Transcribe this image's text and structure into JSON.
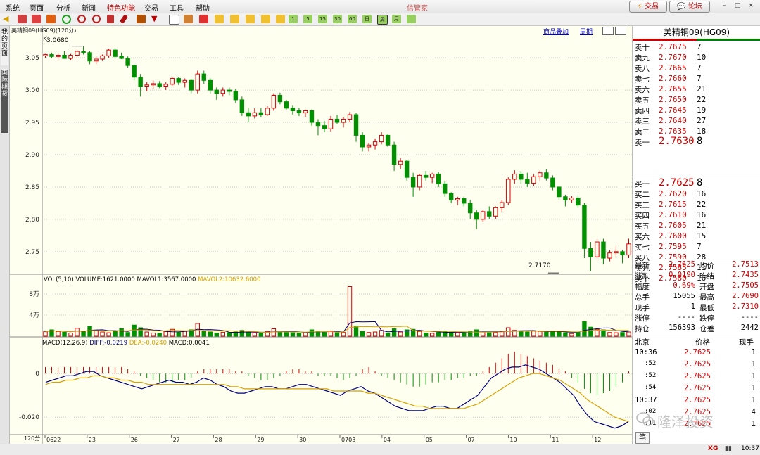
{
  "menu": [
    "系统",
    "页面",
    "分析",
    "新闻",
    "特色功能",
    "交易",
    "工具",
    "帮助"
  ],
  "app_title": "信管家",
  "top_buttons": {
    "trade": "交易",
    "forum": "论坛"
  },
  "window_controls": [
    "–",
    "□",
    "×"
  ],
  "toolbar": {
    "labels": [
      "1",
      "5",
      "15",
      "30",
      "60",
      "日",
      "周",
      "月"
    ]
  },
  "left_tabs": {
    "tab1": "我的页面",
    "tab2": "国际期货"
  },
  "chart_header": {
    "title": "美精铜09(HG09)(120分)",
    "k_label": "K",
    "link_overlay": "商品叠加",
    "link_period": "周期"
  },
  "price_annotations": {
    "high": "3.0680",
    "low": "2.7170"
  },
  "volume_header": {
    "prefix": "VOL(5,10) VOLUME:1621.0000",
    "mavol1": "MAVOL1:3567.0000",
    "mavol2": "MAVOL2:10632.6000"
  },
  "macd_header": {
    "prefix": "MACD(12,26,9)",
    "diff": "DIFF:-0.0219",
    "dea": "DEA:-0.0240",
    "macd": "MACD:0.0041"
  },
  "colors": {
    "up": "#d40000",
    "down": "#009000",
    "diff": "#000080",
    "dea": "#d8a000"
  },
  "chart_data": [
    {
      "type": "candlestick",
      "title": "美精铜09(HG09)(120分)",
      "y_ticks": [
        "3.05",
        "3.00",
        "2.95",
        "2.90",
        "2.85",
        "2.80",
        "2.75"
      ],
      "ylim": [
        2.715,
        3.085
      ],
      "x_ticks": [
        "0622",
        "23",
        "26",
        "27",
        "28",
        "29",
        "30",
        "0703",
        "04",
        "05",
        "07",
        "10",
        "11",
        "12"
      ],
      "annotations": [
        {
          "label": "3.0680",
          "value": 3.068
        },
        {
          "label": "2.7170",
          "value": 2.717
        }
      ],
      "candles": [
        [
          3.053,
          3.056,
          3.05,
          3.055
        ],
        [
          3.055,
          3.058,
          3.049,
          3.052
        ],
        [
          3.052,
          3.057,
          3.048,
          3.054
        ],
        [
          3.054,
          3.06,
          3.05,
          3.049
        ],
        [
          3.049,
          3.056,
          3.046,
          3.054
        ],
        [
          3.054,
          3.062,
          3.052,
          3.06
        ],
        [
          3.06,
          3.068,
          3.055,
          3.058
        ],
        [
          3.058,
          3.06,
          3.04,
          3.045
        ],
        [
          3.045,
          3.052,
          3.04,
          3.048
        ],
        [
          3.048,
          3.055,
          3.045,
          3.053
        ],
        [
          3.053,
          3.064,
          3.05,
          3.062
        ],
        [
          3.062,
          3.065,
          3.05,
          3.052
        ],
        [
          3.052,
          3.058,
          3.048,
          3.049
        ],
        [
          3.049,
          3.052,
          3.035,
          3.038
        ],
        [
          3.038,
          3.04,
          3.015,
          3.02
        ],
        [
          3.02,
          3.025,
          2.99,
          3.005
        ],
        [
          3.005,
          3.012,
          2.998,
          3.008
        ],
        [
          3.008,
          3.015,
          3.002,
          3.01
        ],
        [
          3.01,
          3.014,
          3.003,
          3.005
        ],
        [
          3.005,
          3.012,
          3.0,
          3.009
        ],
        [
          3.009,
          3.02,
          3.006,
          3.018
        ],
        [
          3.018,
          3.02,
          3.008,
          3.012
        ],
        [
          3.012,
          3.018,
          3.004,
          3.015
        ],
        [
          3.015,
          3.017,
          2.995,
          3.0
        ],
        [
          3.0,
          3.03,
          2.995,
          3.025
        ],
        [
          3.025,
          3.03,
          3.01,
          3.015
        ],
        [
          3.015,
          3.018,
          2.995,
          3.0
        ],
        [
          3.0,
          3.004,
          2.985,
          2.995
        ],
        [
          2.995,
          3.004,
          2.99,
          3.0
        ],
        [
          3.0,
          3.004,
          2.992,
          2.998
        ],
        [
          2.998,
          3.002,
          2.98,
          2.985
        ],
        [
          2.985,
          2.99,
          2.96,
          2.965
        ],
        [
          2.965,
          2.972,
          2.95,
          2.96
        ],
        [
          2.96,
          2.972,
          2.956,
          2.965
        ],
        [
          2.965,
          2.972,
          2.958,
          2.962
        ],
        [
          2.962,
          2.975,
          2.96,
          2.972
        ],
        [
          2.972,
          2.995,
          2.968,
          2.992
        ],
        [
          2.992,
          2.996,
          2.978,
          2.982
        ],
        [
          2.982,
          2.985,
          2.97,
          2.972
        ],
        [
          2.972,
          2.976,
          2.962,
          2.968
        ],
        [
          2.968,
          2.972,
          2.96,
          2.965
        ],
        [
          2.965,
          2.97,
          2.958,
          2.968
        ],
        [
          2.968,
          2.97,
          2.945,
          2.95
        ],
        [
          2.95,
          2.955,
          2.93,
          2.945
        ],
        [
          2.945,
          2.952,
          2.935,
          2.94
        ],
        [
          2.94,
          2.96,
          2.936,
          2.955
        ],
        [
          2.955,
          2.962,
          2.948,
          2.95
        ],
        [
          2.95,
          2.958,
          2.942,
          2.955
        ],
        [
          2.955,
          2.966,
          2.95,
          2.962
        ],
        [
          2.962,
          2.965,
          2.92,
          2.93
        ],
        [
          2.93,
          2.935,
          2.905,
          2.912
        ],
        [
          2.912,
          2.918,
          2.905,
          2.915
        ],
        [
          2.915,
          2.925,
          2.908,
          2.92
        ],
        [
          2.92,
          2.935,
          2.916,
          2.93
        ],
        [
          2.93,
          2.932,
          2.912,
          2.915
        ],
        [
          2.915,
          2.92,
          2.875,
          2.885
        ],
        [
          2.885,
          2.895,
          2.878,
          2.89
        ],
        [
          2.89,
          2.892,
          2.86,
          2.865
        ],
        [
          2.865,
          2.872,
          2.835,
          2.85
        ],
        [
          2.85,
          2.87,
          2.845,
          2.868
        ],
        [
          2.868,
          2.875,
          2.86,
          2.865
        ],
        [
          2.865,
          2.872,
          2.856,
          2.87
        ],
        [
          2.87,
          2.873,
          2.85,
          2.855
        ],
        [
          2.855,
          2.86,
          2.835,
          2.84
        ],
        [
          2.84,
          2.842,
          2.825,
          2.83
        ],
        [
          2.83,
          2.835,
          2.822,
          2.832
        ],
        [
          2.832,
          2.835,
          2.82,
          2.825
        ],
        [
          2.825,
          2.83,
          2.8,
          2.81
        ],
        [
          2.81,
          2.815,
          2.785,
          2.8
        ],
        [
          2.8,
          2.815,
          2.796,
          2.812
        ],
        [
          2.812,
          2.82,
          2.8,
          2.805
        ],
        [
          2.805,
          2.82,
          2.8,
          2.818
        ],
        [
          2.818,
          2.83,
          2.812,
          2.826
        ],
        [
          2.826,
          2.865,
          2.822,
          2.862
        ],
        [
          2.862,
          2.876,
          2.855,
          2.87
        ],
        [
          2.87,
          2.875,
          2.855,
          2.862
        ],
        [
          2.862,
          2.872,
          2.85,
          2.856
        ],
        [
          2.856,
          2.87,
          2.852,
          2.866
        ],
        [
          2.866,
          2.876,
          2.86,
          2.872
        ],
        [
          2.872,
          2.878,
          2.86,
          2.864
        ],
        [
          2.864,
          2.868,
          2.845,
          2.85
        ],
        [
          2.85,
          2.852,
          2.83,
          2.835
        ],
        [
          2.835,
          2.838,
          2.82,
          2.83
        ],
        [
          2.83,
          2.836,
          2.826,
          2.833
        ],
        [
          2.833,
          2.836,
          2.818,
          2.822
        ],
        [
          2.822,
          2.825,
          2.74,
          2.755
        ],
        [
          2.755,
          2.765,
          2.72,
          2.742
        ],
        [
          2.742,
          2.77,
          2.738,
          2.765
        ],
        [
          2.765,
          2.77,
          2.73,
          2.74
        ],
        [
          2.74,
          2.752,
          2.735,
          2.748
        ],
        [
          2.748,
          2.758,
          2.742,
          2.75
        ],
        [
          2.75,
          2.752,
          2.732,
          2.745
        ],
        [
          2.745,
          2.77,
          2.74,
          2.762
        ]
      ]
    },
    {
      "type": "bar",
      "title": "VOL(5,10)",
      "y_ticks": [
        "8万",
        "4万"
      ],
      "ylim": [
        0,
        100000
      ],
      "values": [
        8500,
        12000,
        9000,
        7500,
        6000,
        15000,
        9000,
        18000,
        11000,
        8000,
        6500,
        9500,
        14000,
        7000,
        21000,
        16000,
        8000,
        6000,
        5500,
        9000,
        13000,
        7000,
        10000,
        12000,
        24000,
        9000,
        8000,
        6000,
        7500,
        6500,
        8000,
        11000,
        7000,
        6000,
        5500,
        9000,
        14000,
        8000,
        7000,
        6500,
        6000,
        7000,
        12000,
        9000,
        7000,
        10000,
        6500,
        7000,
        9000,
        19000,
        9000,
        7000,
        8000,
        11000,
        6000,
        14000,
        8000,
        12000,
        13000,
        9000,
        6000,
        5500,
        7000,
        10000,
        7500,
        6000,
        6500,
        9000,
        12000,
        8000,
        6500,
        7000,
        9000,
        16000,
        11000,
        9000,
        8000,
        9500,
        9000,
        8000,
        10000,
        8000,
        6500,
        5000,
        7000,
        28000,
        17000,
        13000,
        12000,
        7000,
        6500,
        7000,
        8000
      ],
      "spike": {
        "index": 48,
        "value": 94000
      },
      "mavol_note": "curves"
    },
    {
      "type": "macd",
      "title": "MACD(12,26,9)",
      "y_ticks": [
        "0",
        "-0.020"
      ],
      "ylim": [
        -0.028,
        0.012
      ],
      "histogram": [
        0.003,
        0.003,
        0.003,
        0.003,
        0.003,
        0.003,
        0.003,
        0.003,
        0.003,
        0.003,
        0.003,
        0.003,
        0.003,
        0.002,
        0.001,
        -0.001,
        -0.002,
        -0.003,
        -0.004,
        -0.004,
        -0.004,
        -0.003,
        -0.003,
        -0.002,
        0.001,
        0.002,
        0.002,
        0.002,
        0.002,
        0.002,
        0.001,
        0.001,
        -0.001,
        -0.002,
        -0.003,
        -0.003,
        -0.002,
        -0.001,
        0.001,
        0.002,
        0.002,
        0.001,
        0.001,
        -0.001,
        -0.001,
        -0.001,
        -0.002,
        -0.003,
        -0.002,
        -0.001,
        0.002,
        0.003,
        0.001,
        -0.001,
        -0.002,
        -0.003,
        -0.004,
        -0.005,
        -0.006,
        -0.006,
        -0.005,
        -0.004,
        -0.004,
        -0.003,
        -0.003,
        -0.002,
        -0.002,
        -0.001,
        -0.001,
        0.001,
        0.003,
        0.005,
        0.007,
        0.009,
        0.01,
        0.009,
        0.008,
        0.007,
        0.006,
        0.005,
        0.004,
        0.002,
        0.001,
        -0.002,
        -0.004,
        -0.007,
        -0.009,
        -0.01,
        -0.009,
        -0.008,
        -0.006,
        -0.004,
        0.001
      ],
      "diff": [
        -0.004,
        -0.003,
        -0.002,
        -0.001,
        -0.001,
        0.0,
        0.001,
        0.001,
        -0.001,
        -0.002,
        -0.003,
        -0.004,
        -0.005,
        -0.006,
        -0.007,
        -0.006,
        -0.005,
        -0.004,
        -0.003,
        -0.004,
        -0.004,
        -0.005,
        -0.004,
        -0.002,
        -0.003,
        -0.005,
        -0.006,
        -0.008,
        -0.009,
        -0.009,
        -0.008,
        -0.007,
        -0.006,
        -0.006,
        -0.007,
        -0.007,
        -0.006,
        -0.005,
        -0.005,
        -0.006,
        -0.007,
        -0.008,
        -0.009,
        -0.01,
        -0.008,
        -0.007,
        -0.006,
        -0.008,
        -0.009,
        -0.011,
        -0.013,
        -0.015,
        -0.016,
        -0.017,
        -0.017,
        -0.017,
        -0.016,
        -0.015,
        -0.015,
        -0.016,
        -0.016,
        -0.014,
        -0.012,
        -0.01,
        -0.006,
        -0.002,
        0.0,
        0.002,
        0.003,
        0.003,
        0.004,
        0.003,
        0.002,
        0.0,
        -0.002,
        -0.004,
        -0.007,
        -0.01,
        -0.015,
        -0.019,
        -0.022,
        -0.023,
        -0.024,
        -0.025,
        -0.024,
        -0.022
      ],
      "dea": [
        -0.005,
        -0.004,
        -0.004,
        -0.003,
        -0.003,
        -0.002,
        -0.002,
        -0.001,
        -0.001,
        -0.002,
        -0.002,
        -0.003,
        -0.003,
        -0.004,
        -0.004,
        -0.005,
        -0.005,
        -0.005,
        -0.005,
        -0.005,
        -0.005,
        -0.005,
        -0.005,
        -0.005,
        -0.005,
        -0.005,
        -0.005,
        -0.006,
        -0.006,
        -0.007,
        -0.007,
        -0.007,
        -0.007,
        -0.007,
        -0.007,
        -0.007,
        -0.007,
        -0.007,
        -0.007,
        -0.007,
        -0.007,
        -0.007,
        -0.008,
        -0.008,
        -0.008,
        -0.008,
        -0.008,
        -0.009,
        -0.009,
        -0.01,
        -0.011,
        -0.012,
        -0.013,
        -0.014,
        -0.015,
        -0.015,
        -0.016,
        -0.016,
        -0.016,
        -0.016,
        -0.016,
        -0.016,
        -0.015,
        -0.014,
        -0.012,
        -0.01,
        -0.008,
        -0.006,
        -0.004,
        -0.002,
        -0.001,
        0.0,
        0.0,
        -0.001,
        -0.002,
        -0.003,
        -0.005,
        -0.007,
        -0.009,
        -0.012,
        -0.014,
        -0.016,
        -0.018,
        -0.02,
        -0.021,
        -0.022
      ]
    }
  ],
  "quote_panel": {
    "title": "美精铜09(HG09)",
    "sell": [
      {
        "label": "卖十",
        "price": "2.7675",
        "vol": "7"
      },
      {
        "label": "卖九",
        "price": "2.7670",
        "vol": "10"
      },
      {
        "label": "卖八",
        "price": "2.7665",
        "vol": "7"
      },
      {
        "label": "卖七",
        "price": "2.7660",
        "vol": "7"
      },
      {
        "label": "卖六",
        "price": "2.7655",
        "vol": "21"
      },
      {
        "label": "卖五",
        "price": "2.7650",
        "vol": "22"
      },
      {
        "label": "卖四",
        "price": "2.7645",
        "vol": "19"
      },
      {
        "label": "卖三",
        "price": "2.7640",
        "vol": "27"
      },
      {
        "label": "卖二",
        "price": "2.7635",
        "vol": "18"
      },
      {
        "label": "卖一",
        "price": "2.7630",
        "vol": "8"
      }
    ],
    "buy": [
      {
        "label": "买一",
        "price": "2.7625",
        "vol": "8"
      },
      {
        "label": "买二",
        "price": "2.7620",
        "vol": "16"
      },
      {
        "label": "买三",
        "price": "2.7615",
        "vol": "22"
      },
      {
        "label": "买四",
        "price": "2.7610",
        "vol": "16"
      },
      {
        "label": "买五",
        "price": "2.7605",
        "vol": "21"
      },
      {
        "label": "买六",
        "price": "2.7600",
        "vol": "15"
      },
      {
        "label": "买七",
        "price": "2.7595",
        "vol": "7"
      },
      {
        "label": "买八",
        "price": "2.7590",
        "vol": "28"
      },
      {
        "label": "买九",
        "price": "2.7585",
        "vol": "11"
      },
      {
        "label": "买十",
        "price": "2.7580",
        "vol": "16"
      }
    ],
    "stats": [
      {
        "k1": "最新",
        "v1": "2.7625",
        "k2": "均价",
        "v2": "2.7513"
      },
      {
        "k1": "涨跌",
        "v1": "0.0190",
        "k2": "昨结",
        "v2": "2.7435"
      },
      {
        "k1": "幅度",
        "v1": "0.69%",
        "k2": "开盘",
        "v2": "2.7505"
      },
      {
        "k1": "总手",
        "v1": "15055",
        "k2": "最高",
        "v2": "2.7690"
      },
      {
        "k1": "现手",
        "v1": "1",
        "k2": "最低",
        "v2": "2.7310"
      },
      {
        "k1": "涨停",
        "v1": "----",
        "k2": "跌停",
        "v2": "----"
      },
      {
        "k1": "持仓",
        "v1": "156393",
        "k2": "仓差",
        "v2": "2442"
      }
    ],
    "ticks_header": {
      "time": "北京",
      "price": "价格",
      "vol": "现手"
    },
    "ticks": [
      {
        "time": "10:36",
        "price": "2.7625",
        "vol": "1"
      },
      {
        "time": ":52",
        "price": "2.7625",
        "vol": "1"
      },
      {
        "time": ":52",
        "price": "2.7625",
        "vol": "1"
      },
      {
        "time": ":54",
        "price": "2.7625",
        "vol": "1"
      },
      {
        "time": "10:37",
        "price": "2.7625",
        "vol": "1"
      },
      {
        "time": ":02",
        "price": "2.7625",
        "vol": "4"
      },
      {
        "time": ":11",
        "price": "2.7625",
        "vol": "1"
      }
    ],
    "bottom_tab": "笔"
  },
  "watermark": "隆泽投资",
  "statusbar": {
    "time": "10:37",
    "brand": "XG"
  },
  "bottom_left_label": "120分"
}
